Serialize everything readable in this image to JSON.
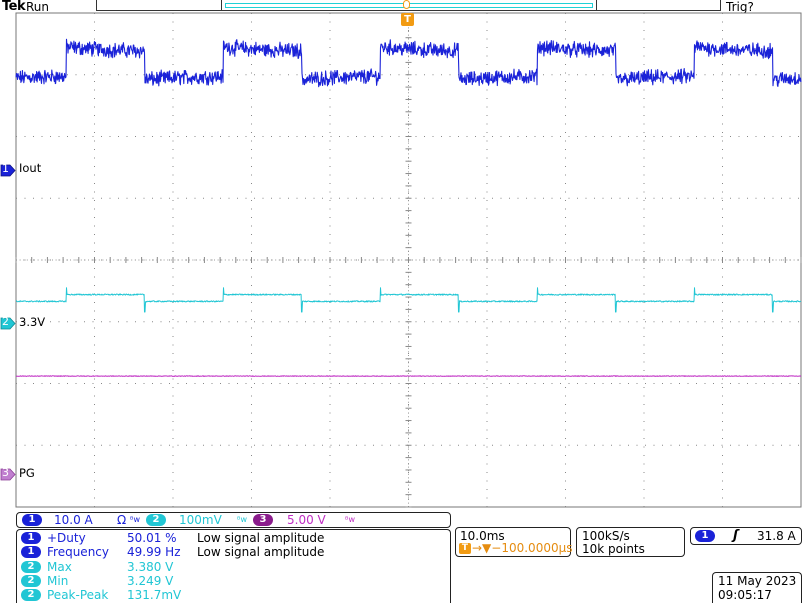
{
  "header": {
    "brand": "Tek",
    "run_state": "Run",
    "trigger_state": "Trig?"
  },
  "channels": [
    {
      "number": "1",
      "label": "Iout",
      "scale": "10.0 A",
      "suffix": "Ω",
      "color": "#1a22d8"
    },
    {
      "number": "2",
      "label": "3.3V",
      "scale": "100mV",
      "color": "#21c6d4"
    },
    {
      "number": "3",
      "label": "PG",
      "scale": "5.00 V",
      "color": "#c02ec4"
    }
  ],
  "trigger_marker": "T",
  "measurements": [
    {
      "ch": "1",
      "name": "+Duty",
      "value": "50.01 %",
      "note": "Low signal amplitude",
      "color": "#1a22d8"
    },
    {
      "ch": "1",
      "name": "Frequency",
      "value": "49.99 Hz",
      "note": "Low signal amplitude",
      "color": "#1a22d8"
    },
    {
      "ch": "2",
      "name": "Max",
      "value": "3.380 V",
      "note": "",
      "color": "#21c6d4"
    },
    {
      "ch": "2",
      "name": "Min",
      "value": "3.249 V",
      "note": "",
      "color": "#21c6d4"
    },
    {
      "ch": "2",
      "name": "Peak-Peak",
      "value": "131.7mV",
      "note": "",
      "color": "#21c6d4"
    }
  ],
  "timebase": {
    "scale": "10.0ms",
    "delay": "→▼−100.0000µs"
  },
  "acquisition": {
    "rate": "100kS/s",
    "points": "10k points"
  },
  "trigger": {
    "source": "1",
    "slope_symbol": "ʃ",
    "level": "31.8 A"
  },
  "datetime": {
    "date": "11 May 2023",
    "time": "09:05:17"
  },
  "chart_data": {
    "type": "line",
    "title": "",
    "xlabel": "",
    "ylabel": "",
    "x_divisions": 10,
    "y_divisions": 8,
    "time_per_div_ms": 10,
    "series": [
      {
        "name": "Iout",
        "color": "#1a22d8",
        "unit": "div",
        "shape": "square",
        "period_div": 2.0,
        "duty": 0.5,
        "high_div": 3.45,
        "low_div": 2.92,
        "first_rise_div": -0.36,
        "noise_div": 0.12
      },
      {
        "name": "3.3V",
        "color": "#21c6d4",
        "unit": "div",
        "shape": "load-step",
        "period_div": 2.0,
        "first_rise_div": -0.36,
        "baseline_div": -0.56,
        "step_high_div": -0.56,
        "step_low_div": -0.67,
        "spike_div": 0.4,
        "noise_div": 0.02
      },
      {
        "name": "PG",
        "color": "#c02ec4",
        "unit": "div",
        "shape": "flat",
        "level_div": -1.88,
        "noise_div": 0.01
      }
    ]
  }
}
